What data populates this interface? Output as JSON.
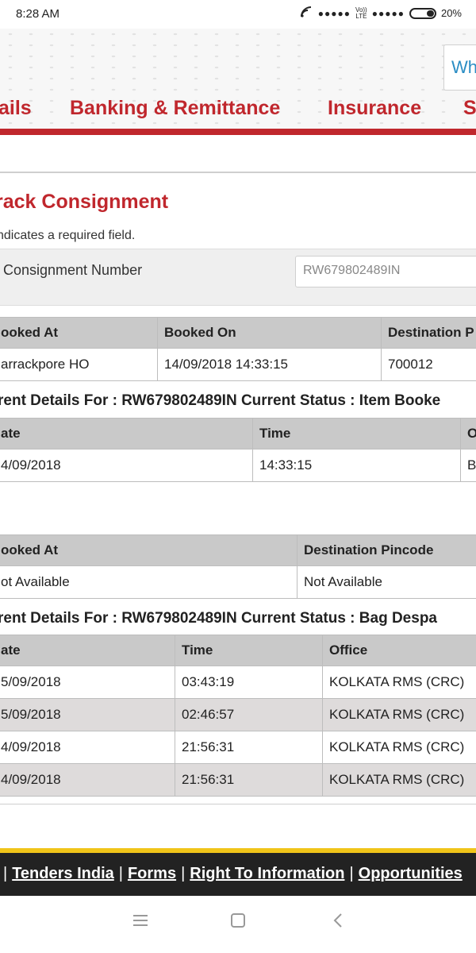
{
  "status_bar": {
    "time": "8:28 AM",
    "signal_label_top": "Vo))",
    "signal_label_bottom": "LTE",
    "battery": "20%"
  },
  "header": {
    "search_text": "Wh",
    "nav": [
      "ails",
      "Banking & Remittance",
      "Insurance",
      "S"
    ]
  },
  "main": {
    "title": "rack Consignment",
    "required_note": "ndicates a required field.",
    "consignment_label": "Consignment Number",
    "consignment_value": "RW679802489IN"
  },
  "booking_table": {
    "headers": [
      "ooked At",
      "Booked On",
      "Destination P"
    ],
    "row": [
      "arrackpore HO",
      "14/09/2018 14:33:15",
      "700012"
    ]
  },
  "details_1": {
    "line": "rent Details For : RW679802489IN    Current Status : Item Booke"
  },
  "events_table_1": {
    "headers": [
      "ate",
      "Time",
      "O"
    ],
    "rows": [
      [
        "4/09/2018",
        "14:33:15",
        "B"
      ]
    ]
  },
  "booking_table_2": {
    "headers": [
      "ooked At",
      "Destination Pincode"
    ],
    "row": [
      "ot Available",
      "Not Available"
    ]
  },
  "details_2": {
    "line": "rent Details For : RW679802489IN    Current Status : Bag Despa"
  },
  "events_table_2": {
    "headers": [
      "ate",
      "Time",
      "Office"
    ],
    "rows": [
      [
        "5/09/2018",
        "03:43:19",
        "KOLKATA RMS (CRC)"
      ],
      [
        "5/09/2018",
        "02:46:57",
        "KOLKATA RMS (CRC)"
      ],
      [
        "4/09/2018",
        "21:56:31",
        "KOLKATA RMS (CRC)"
      ],
      [
        "4/09/2018",
        "21:56:31",
        "KOLKATA RMS (CRC)"
      ]
    ]
  },
  "footer": {
    "links": [
      "Tenders India",
      "Forms",
      "Right To Information",
      "Opportunities"
    ]
  },
  "android_nav": {
    "icons": [
      "menu-icon",
      "home-square-icon",
      "back-chevron-icon"
    ]
  }
}
